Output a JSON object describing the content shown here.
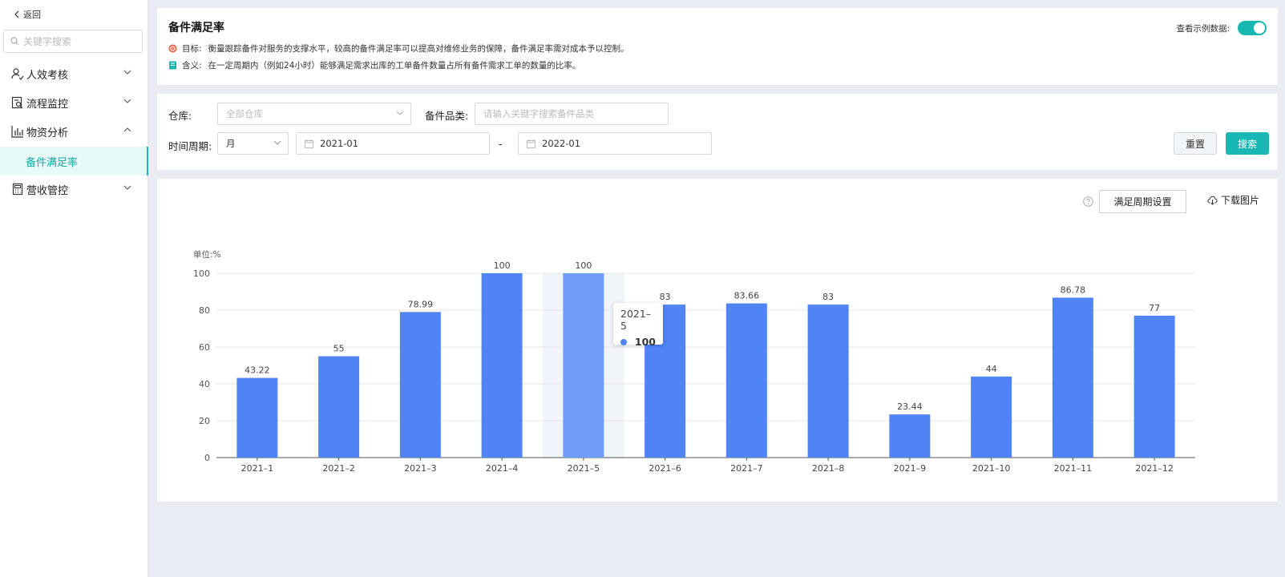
{
  "sidebar": {
    "back_label": "返回",
    "search_placeholder": "关键字搜索",
    "menu": [
      {
        "label": "人效考核"
      },
      {
        "label": "流程监控"
      },
      {
        "label": "物资分析"
      },
      {
        "label": "营收管控"
      }
    ],
    "active_sub": "备件满足率"
  },
  "info": {
    "title": "备件满足率",
    "goal_label": "目标:",
    "goal_text": "衡量跟踪备件对服务的支撑水平，较高的备件满足率可以提高对维修业务的保障，备件满足率需对成本予以控制。",
    "meaning_label": "含义:",
    "meaning_text": "在一定周期内（例如24小时）能够满足需求出库的工单备件数量占所有备件需求工单的数量的比率。",
    "sample_toggle_label": "查看示例数据:",
    "sample_toggle_on": true
  },
  "filters": {
    "warehouse_label": "仓库:",
    "warehouse_placeholder": "全部仓库",
    "category_label": "备件品类:",
    "category_placeholder": "请输入关键字搜索备件品类",
    "period_label": "时间周期:",
    "period_value": "月",
    "date_start": "2021-01",
    "date_sep": "-",
    "date_end": "2022-01",
    "reset_label": "重置",
    "search_label": "搜索"
  },
  "chart_toolbar": {
    "cycle_settings_label": "满足周期设置",
    "download_label": "下载图片"
  },
  "colors": {
    "accent": "#1ab8b4",
    "bar": "#5084f5",
    "bar_highlight": "#6e9cf7"
  },
  "chart_data": {
    "type": "bar",
    "unit_label": "单位:%",
    "categories": [
      "2021–1",
      "2021–2",
      "2021–3",
      "2021–4",
      "2021–5",
      "2021–6",
      "2021–7",
      "2021–8",
      "2021–9",
      "2021–10",
      "2021–11",
      "2021–12"
    ],
    "values": [
      43.22,
      55,
      78.99,
      100,
      100,
      83,
      83.66,
      83,
      23.44,
      44,
      86.78,
      77
    ],
    "ylim": [
      0,
      100
    ],
    "yticks": [
      0,
      20,
      40,
      60,
      80,
      100
    ],
    "grid": true,
    "data_labels": true,
    "highlighted_index": 4,
    "tooltip": {
      "title": "2021–5",
      "value": "100"
    }
  }
}
